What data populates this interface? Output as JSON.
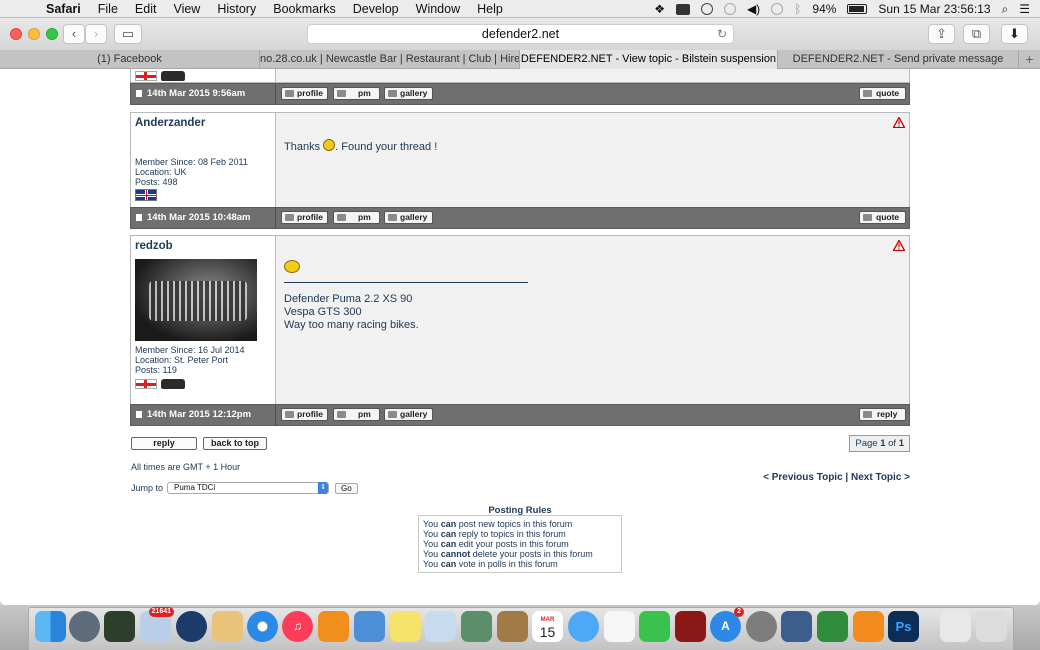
{
  "menubar": {
    "app": "Safari",
    "items": [
      "File",
      "Edit",
      "View",
      "History",
      "Bookmarks",
      "Develop",
      "Window",
      "Help"
    ],
    "battery": "94%",
    "clock": "Sun 15 Mar  23:56:13"
  },
  "browser": {
    "url": "defender2.net",
    "tabs": [
      "(1) Facebook",
      "no.28.co.uk | Newcastle Bar | Restaurant | Club | Hire",
      "DEFENDER2.NET - View topic - Bilstein suspension",
      "DEFENDER2.NET - Send private message"
    ],
    "active_tab": 2,
    "new_tab": "+"
  },
  "buttons": {
    "profile": "profile",
    "pm": "pm",
    "gallery": "gallery",
    "quote": "quote",
    "reply": "reply",
    "back_to_top": "back to top",
    "go": "Go"
  },
  "posts": [
    {
      "date": "14th Mar 2015 9:56am"
    },
    {
      "author": "Anderzander",
      "member_since": "Member Since: 08 Feb 2011",
      "location": "Location: UK",
      "posts": "Posts: 498",
      "message_before": "Thanks ",
      "message_after": ". Found your thread !",
      "date": "14th Mar 2015 10:48am"
    },
    {
      "author": "redzob",
      "member_since": "Member Since: 16 Jul 2014",
      "location": "Location: St. Peter Port",
      "posts": "Posts: 119",
      "signature": [
        "Defender Puma 2.2 XS 90",
        "Vespa GTS 300",
        "Way too many racing bikes."
      ],
      "date": "14th Mar 2015 12:12pm"
    }
  ],
  "pagination": {
    "prefix": "Page ",
    "current": "1",
    "of": " of ",
    "total": "1"
  },
  "timezone": "All times are GMT + 1 Hour",
  "jump_to": {
    "label": "Jump to",
    "selected": "Puma TDCi"
  },
  "topic_nav": {
    "prev": "<  Previous Topic",
    "sep": " | ",
    "next": "Next Topic >"
  },
  "posting_rules": {
    "title": "Posting Rules",
    "lines": [
      {
        "a": "You ",
        "b": "can",
        "c": " post new topics in this forum"
      },
      {
        "a": "You ",
        "b": "can",
        "c": " reply to topics in this forum"
      },
      {
        "a": "You ",
        "b": "can",
        "c": " edit your posts in this forum"
      },
      {
        "a": "You ",
        "b": "cannot",
        "c": " delete your posts in this forum"
      },
      {
        "a": "You ",
        "b": "can",
        "c": " vote in polls in this forum"
      }
    ]
  },
  "dock": {
    "mail_badge": "21641",
    "appstore_badge": "2",
    "calendar_month": "MAR",
    "calendar_day": "15",
    "photoshop": "Ps"
  }
}
